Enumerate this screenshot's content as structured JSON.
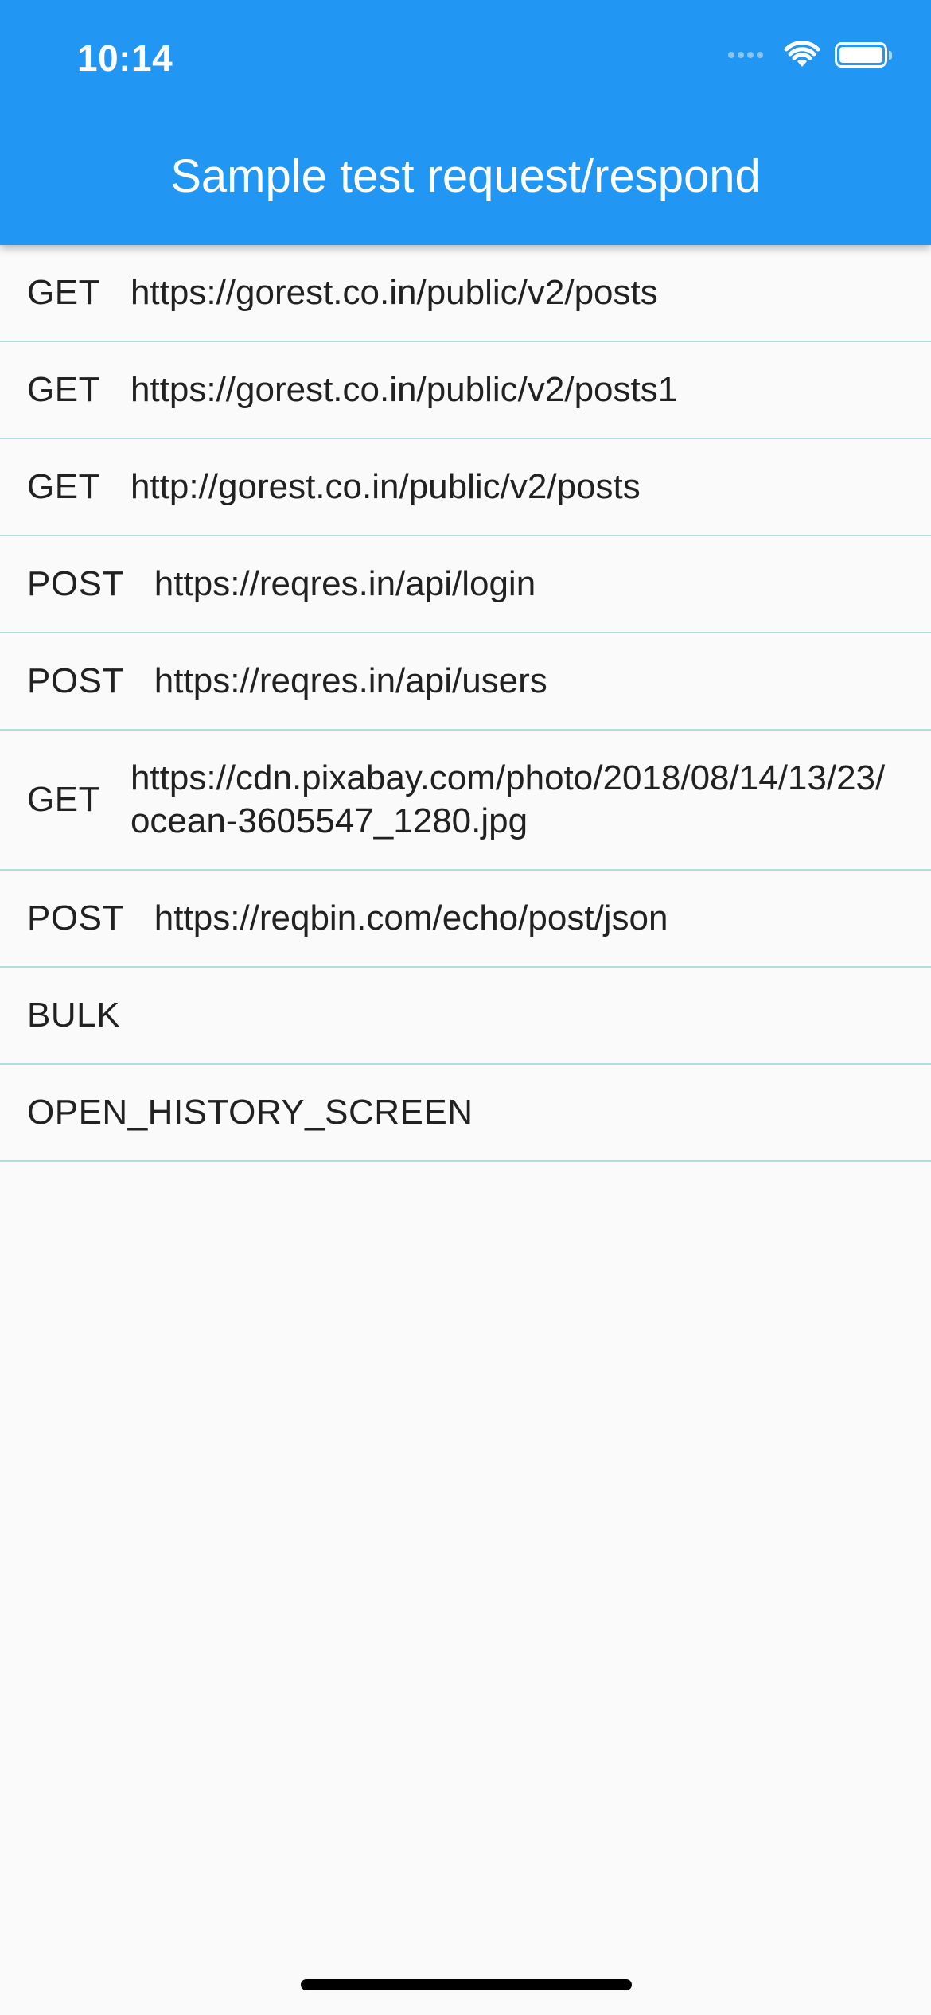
{
  "status_bar": {
    "time": "10:14",
    "icons": [
      "cellular-signal-icon",
      "wifi-icon",
      "battery-icon"
    ]
  },
  "app_bar": {
    "title": "Sample test request/respond",
    "color": "#2196f3"
  },
  "requests": [
    {
      "method": "GET",
      "url": "https://gorest.co.in/public/v2/posts"
    },
    {
      "method": "GET",
      "url": "https://gorest.co.in/public/v2/posts1"
    },
    {
      "method": "GET",
      "url": "http://gorest.co.in/public/v2/posts"
    },
    {
      "method": "POST",
      "url": "https://reqres.in/api/login"
    },
    {
      "method": "POST",
      "url": "https://reqres.in/api/users"
    },
    {
      "method": "GET",
      "url": "https://cdn.pixabay.com/photo/2018/08/14/13/23/ocean-3605547_1280.jpg"
    },
    {
      "method": "POST",
      "url": "https://reqbin.com/echo/post/json"
    },
    {
      "method": "BULK",
      "url": ""
    },
    {
      "method": "OPEN_HISTORY_SCREEN",
      "url": ""
    }
  ],
  "colors": {
    "divider": "#b2dfdb",
    "background": "#fafafa",
    "text": "#212121"
  }
}
